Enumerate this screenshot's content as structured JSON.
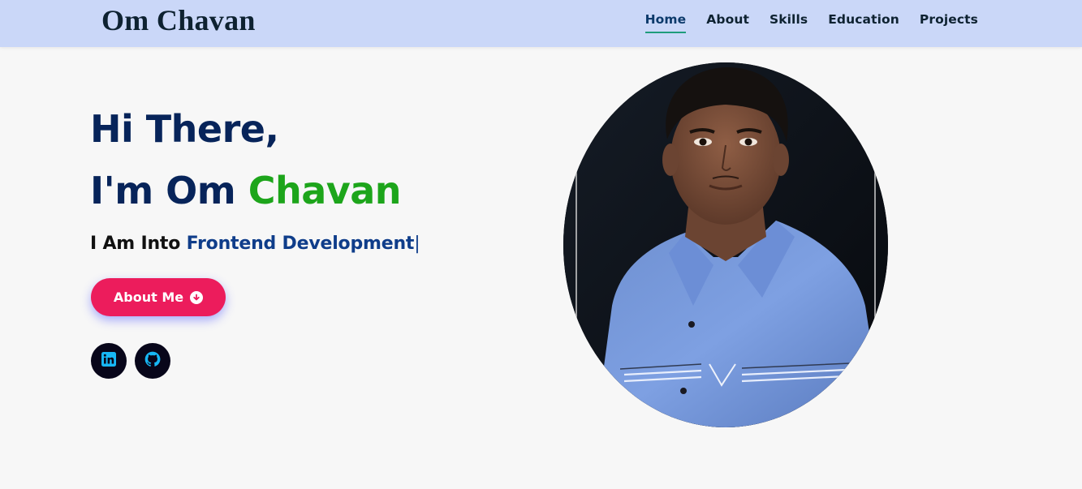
{
  "header": {
    "logo": "Om Chavan",
    "nav": [
      {
        "label": "Home",
        "active": true
      },
      {
        "label": "About"
      },
      {
        "label": "Skills"
      },
      {
        "label": "Education"
      },
      {
        "label": "Projects"
      }
    ]
  },
  "hero": {
    "greeting": "Hi There,",
    "intro_prefix": "I'm Om ",
    "intro_name": "Chavan",
    "typing_prefix": "I Am Into ",
    "typing_text": "Frontend Development",
    "cursor": "|",
    "about_button": "About Me",
    "socials": [
      {
        "name": "linkedin-icon"
      },
      {
        "name": "github-icon"
      }
    ],
    "photo": "portrait-photo"
  },
  "colors": {
    "navbar": "#cad7f8",
    "heading": "#07245a",
    "accent_green": "#1da51b",
    "button": "#ec1c5c",
    "social_bg": "#08061a",
    "social_icon": "#17b7f5"
  }
}
